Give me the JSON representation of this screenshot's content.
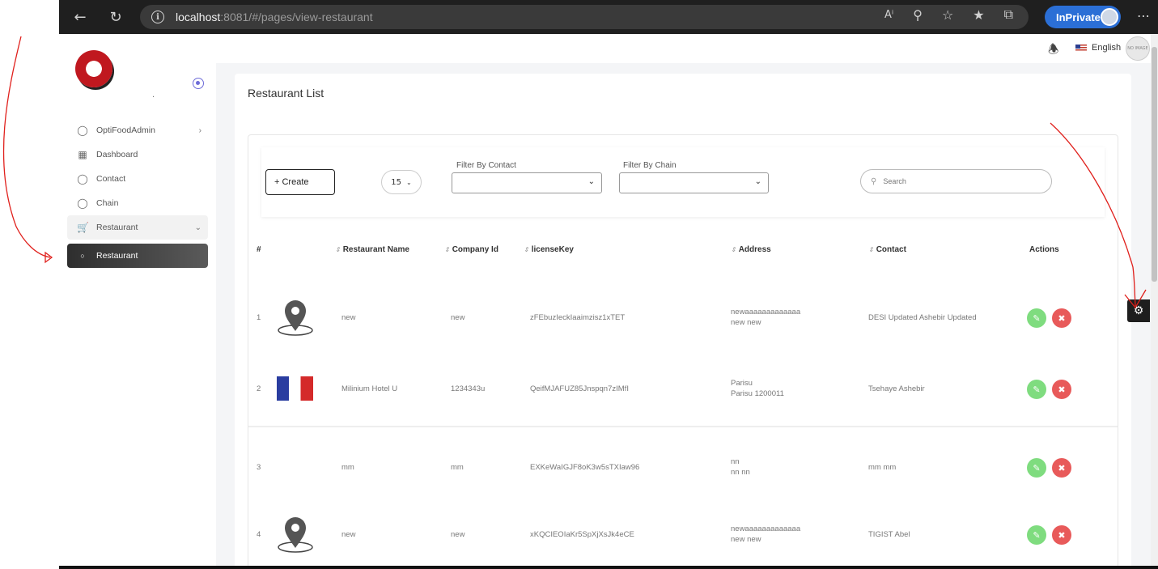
{
  "browser": {
    "url_host": "localhost",
    "url_rest": ":8081/#/pages/view-restaurant",
    "inprivate_label": "InPrivate"
  },
  "header": {
    "language": "English",
    "avatar_text": "NO IMAGE"
  },
  "sidebar": {
    "items": [
      {
        "label": "OptiFoodAdmin",
        "icon": "user-icon"
      },
      {
        "label": "Dashboard",
        "icon": "grid-icon"
      },
      {
        "label": "Contact",
        "icon": "user-icon"
      },
      {
        "label": "Chain",
        "icon": "user-icon"
      },
      {
        "label": "Restaurant",
        "icon": "cart-icon"
      }
    ],
    "active_sub": "Restaurant"
  },
  "page": {
    "title": "Restaurant List",
    "create_label": "+ Create",
    "per_page": "15",
    "filter_contact_label": "Filter By Contact",
    "filter_chain_label": "Filter By Chain",
    "search_placeholder": "Search"
  },
  "table": {
    "headers": [
      "#",
      "Restaurant Name",
      "Company Id",
      "licenseKey",
      "Address",
      "Contact",
      "Actions"
    ],
    "rows": [
      {
        "num": "1",
        "image": "location-pin",
        "name": "new",
        "company": "new",
        "license": "zFEbuzIeckIaaimzisz1xTET",
        "addr1": "newaaaaaaaaaaaaa",
        "addr2": "new new",
        "contact": "DESI Updated Ashebir Updated"
      },
      {
        "num": "2",
        "image": "flag-france",
        "name": "Milinium Hotel U",
        "company": "1234343u",
        "license": "QeifMJAFUZ85Jnspqn7zIMfI",
        "addr1": "Parisu",
        "addr2": "Parisu 1200011",
        "contact": "Tsehaye Ashebir"
      },
      {
        "num": "3",
        "image": "none",
        "name": "mm",
        "company": "mm",
        "license": "EXKeWaIGJF8oK3w5sTXIaw96",
        "addr1": "nn",
        "addr2": "nn nn",
        "contact": "mm mm"
      },
      {
        "num": "4",
        "image": "location-pin",
        "name": "new",
        "company": "new",
        "license": "xKQCIEOIaKr5SpXjXsJk4eCE",
        "addr1": "newaaaaaaaaaaaaa",
        "addr2": "new new",
        "contact": "TIGIST Abel"
      }
    ]
  },
  "colors": {
    "edit": "#7fdc7f",
    "delete": "#e85a5a",
    "annotation": "#e0201c",
    "active_menu": "#2e2e2e"
  }
}
